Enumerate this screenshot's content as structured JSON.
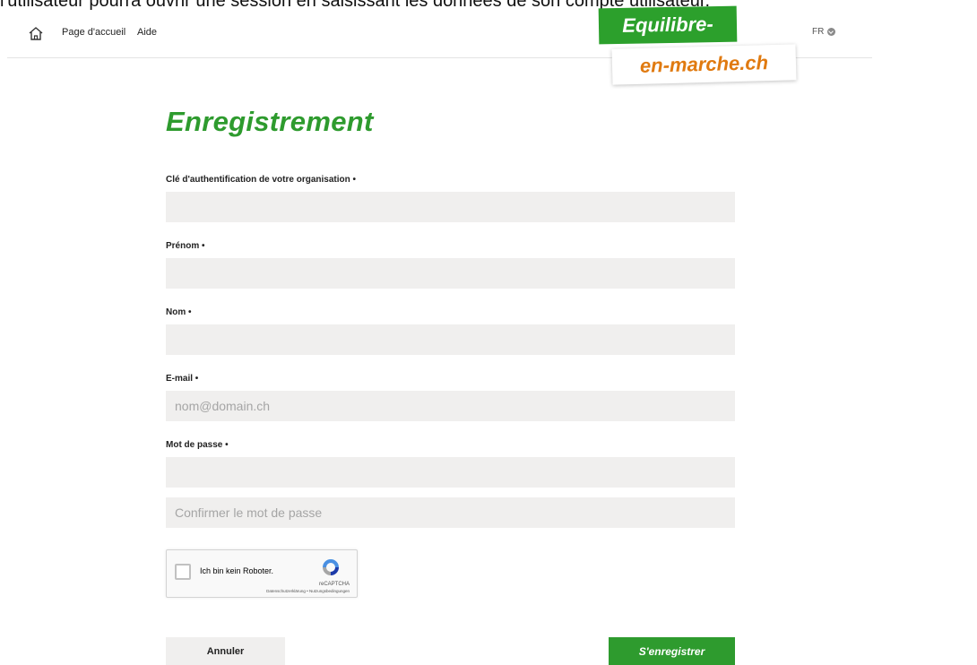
{
  "caption": "l'utilisateur pourra ouvrir une session en saisissant les données de son compte utilisateur.",
  "nav": {
    "home_label": "Page d'accueil",
    "help_label": "Aide",
    "language": "FR"
  },
  "logo": {
    "line1": "Equilibre-",
    "line2": "en-marche.ch"
  },
  "page_title": "Enregistrement",
  "form": {
    "org_key_label": "Clé d'authentification de votre organisation •",
    "first_name_label": "Prénom •",
    "last_name_label": "Nom •",
    "email_label": "E-mail •",
    "email_placeholder": "nom@domain.ch",
    "password_label": "Mot de passe •",
    "confirm_password_placeholder": "Confirmer le mot de passe"
  },
  "recaptcha": {
    "label": "Ich bin kein Roboter.",
    "brand": "reCAPTCHA",
    "terms": "Datenschutzerklärung • Nutzungsbedingungen"
  },
  "buttons": {
    "cancel": "Annuler",
    "register": "S'enregistrer"
  },
  "colors": {
    "brand_green": "#2e9b2e",
    "brand_orange": "#e07a10",
    "input_bg": "#f0efee"
  }
}
